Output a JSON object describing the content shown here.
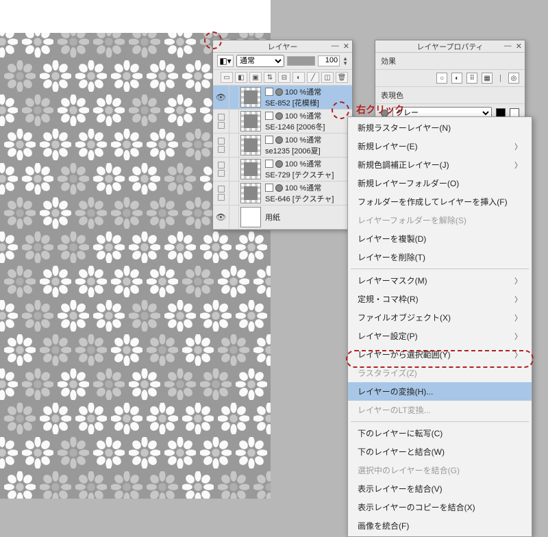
{
  "annotation": {
    "right_click": "右クリック"
  },
  "layers_panel": {
    "title": "レイヤー",
    "blend_mode": "通常",
    "opacity": "100",
    "layers": [
      {
        "opacity": "100 %通常",
        "name": "SE-852 [花模様]",
        "visible": true,
        "selected": true
      },
      {
        "opacity": "100 %通常",
        "name": "SE-1246 [2006冬]",
        "visible": false,
        "selected": false
      },
      {
        "opacity": "100 %通常",
        "name": "se1235 [2006夏]",
        "visible": false,
        "selected": false
      },
      {
        "opacity": "100 %通常",
        "name": "SE-729 [テクスチャ]",
        "visible": false,
        "selected": false
      },
      {
        "opacity": "100 %通常",
        "name": "SE-646 [テクスチャ]",
        "visible": false,
        "selected": false
      },
      {
        "opacity": "",
        "name": "用紙",
        "visible": true,
        "selected": false,
        "paper": true
      }
    ]
  },
  "props_panel": {
    "title": "レイヤープロパティ",
    "effect_label": "効果",
    "color_label": "表現色",
    "color_value": "グレー"
  },
  "context_menu": {
    "items": [
      {
        "label": "新規ラスターレイヤー(N)",
        "sub": false,
        "disabled": false
      },
      {
        "label": "新規レイヤー(E)",
        "sub": true,
        "disabled": false
      },
      {
        "label": "新規色調補正レイヤー(J)",
        "sub": true,
        "disabled": false
      },
      {
        "label": "新規レイヤーフォルダー(O)",
        "sub": false,
        "disabled": false
      },
      {
        "label": "フォルダーを作成してレイヤーを挿入(F)",
        "sub": false,
        "disabled": false
      },
      {
        "label": "レイヤーフォルダーを解除(S)",
        "sub": false,
        "disabled": true
      },
      {
        "label": "レイヤーを複製(D)",
        "sub": false,
        "disabled": false
      },
      {
        "label": "レイヤーを削除(T)",
        "sub": false,
        "disabled": false
      },
      {
        "sep": true
      },
      {
        "label": "レイヤーマスク(M)",
        "sub": true,
        "disabled": false
      },
      {
        "label": "定規・コマ枠(R)",
        "sub": true,
        "disabled": false
      },
      {
        "label": "ファイルオブジェクト(X)",
        "sub": true,
        "disabled": false
      },
      {
        "label": "レイヤー設定(P)",
        "sub": true,
        "disabled": false
      },
      {
        "label": "レイヤーから選択範囲(Y)",
        "sub": true,
        "disabled": false
      },
      {
        "label": "ラスタライズ(Z)",
        "sub": false,
        "disabled": true
      },
      {
        "label": "レイヤーの変換(H)...",
        "sub": false,
        "disabled": false,
        "hilite": true
      },
      {
        "label": "レイヤーのLT変換...",
        "sub": false,
        "disabled": true
      },
      {
        "sep": true
      },
      {
        "label": "下のレイヤーに転写(C)",
        "sub": false,
        "disabled": false
      },
      {
        "label": "下のレイヤーと結合(W)",
        "sub": false,
        "disabled": false
      },
      {
        "label": "選択中のレイヤーを結合(G)",
        "sub": false,
        "disabled": true
      },
      {
        "label": "表示レイヤーを結合(V)",
        "sub": false,
        "disabled": false
      },
      {
        "label": "表示レイヤーのコピーを結合(X)",
        "sub": false,
        "disabled": false
      },
      {
        "label": "画像を統合(F)",
        "sub": false,
        "disabled": false
      }
    ]
  }
}
